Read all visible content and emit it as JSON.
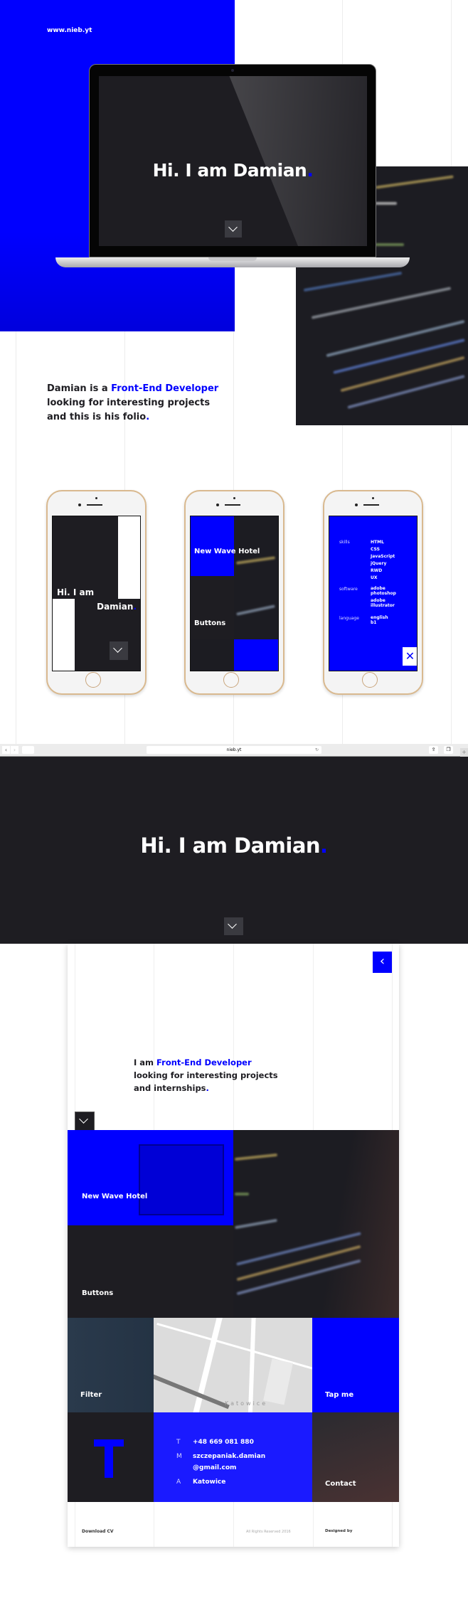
{
  "intro": {
    "site_url": "www.nieb.yt",
    "laptop_heading": "Hi. I am Damian",
    "heading_dot": ".",
    "paragraph": {
      "prefix": "Damian is a ",
      "highlight": "Front-End Developer",
      "line2": "looking for interesting projects",
      "line3": "and this is his folio",
      "dot": "."
    }
  },
  "phones": {
    "phone1": {
      "line1": "Hi. I am",
      "line2": "Damian",
      "dot": "."
    },
    "phone2": {
      "project1": "New Wave Hotel",
      "project2": "Buttons"
    },
    "phone3": {
      "groups": [
        {
          "label": "skills",
          "items": [
            "HTML",
            "CSS",
            "JavaScript",
            "jQuery",
            "RWD",
            "UX"
          ]
        },
        {
          "label": "software",
          "items": [
            "adobe photoshop",
            "adobe illustrator"
          ]
        },
        {
          "label": "language",
          "items": [
            "english b1"
          ]
        }
      ]
    }
  },
  "browser": {
    "url": "nieb.yt"
  },
  "site": {
    "hero_heading": "Hi. I am Damian",
    "hero_dot": ".",
    "about": {
      "prefix": "I am ",
      "highlight": "Front-End Developer",
      "line2": "looking for interesting projects",
      "line3": "and internships",
      "dot": "."
    },
    "tiles": {
      "project1": "New Wave Hotel",
      "project2": "Buttons",
      "filter": "Filter",
      "tap": "Tap me",
      "contact": "Contact",
      "logo": "T"
    },
    "map_label": "Katowice",
    "contact": [
      {
        "key": "T",
        "value": "+48 669 081 880"
      },
      {
        "key": "M",
        "value": "szczepaniak.damian",
        "value2": "@gmail.com"
      },
      {
        "key": "A",
        "value": "Katowice"
      }
    ],
    "footer": {
      "download": "Download CV",
      "rights": "All Rights Reserved 2016",
      "designed": "Designed by"
    }
  },
  "colors": {
    "accent": "#0000ff",
    "dark": "#1e1d22"
  }
}
